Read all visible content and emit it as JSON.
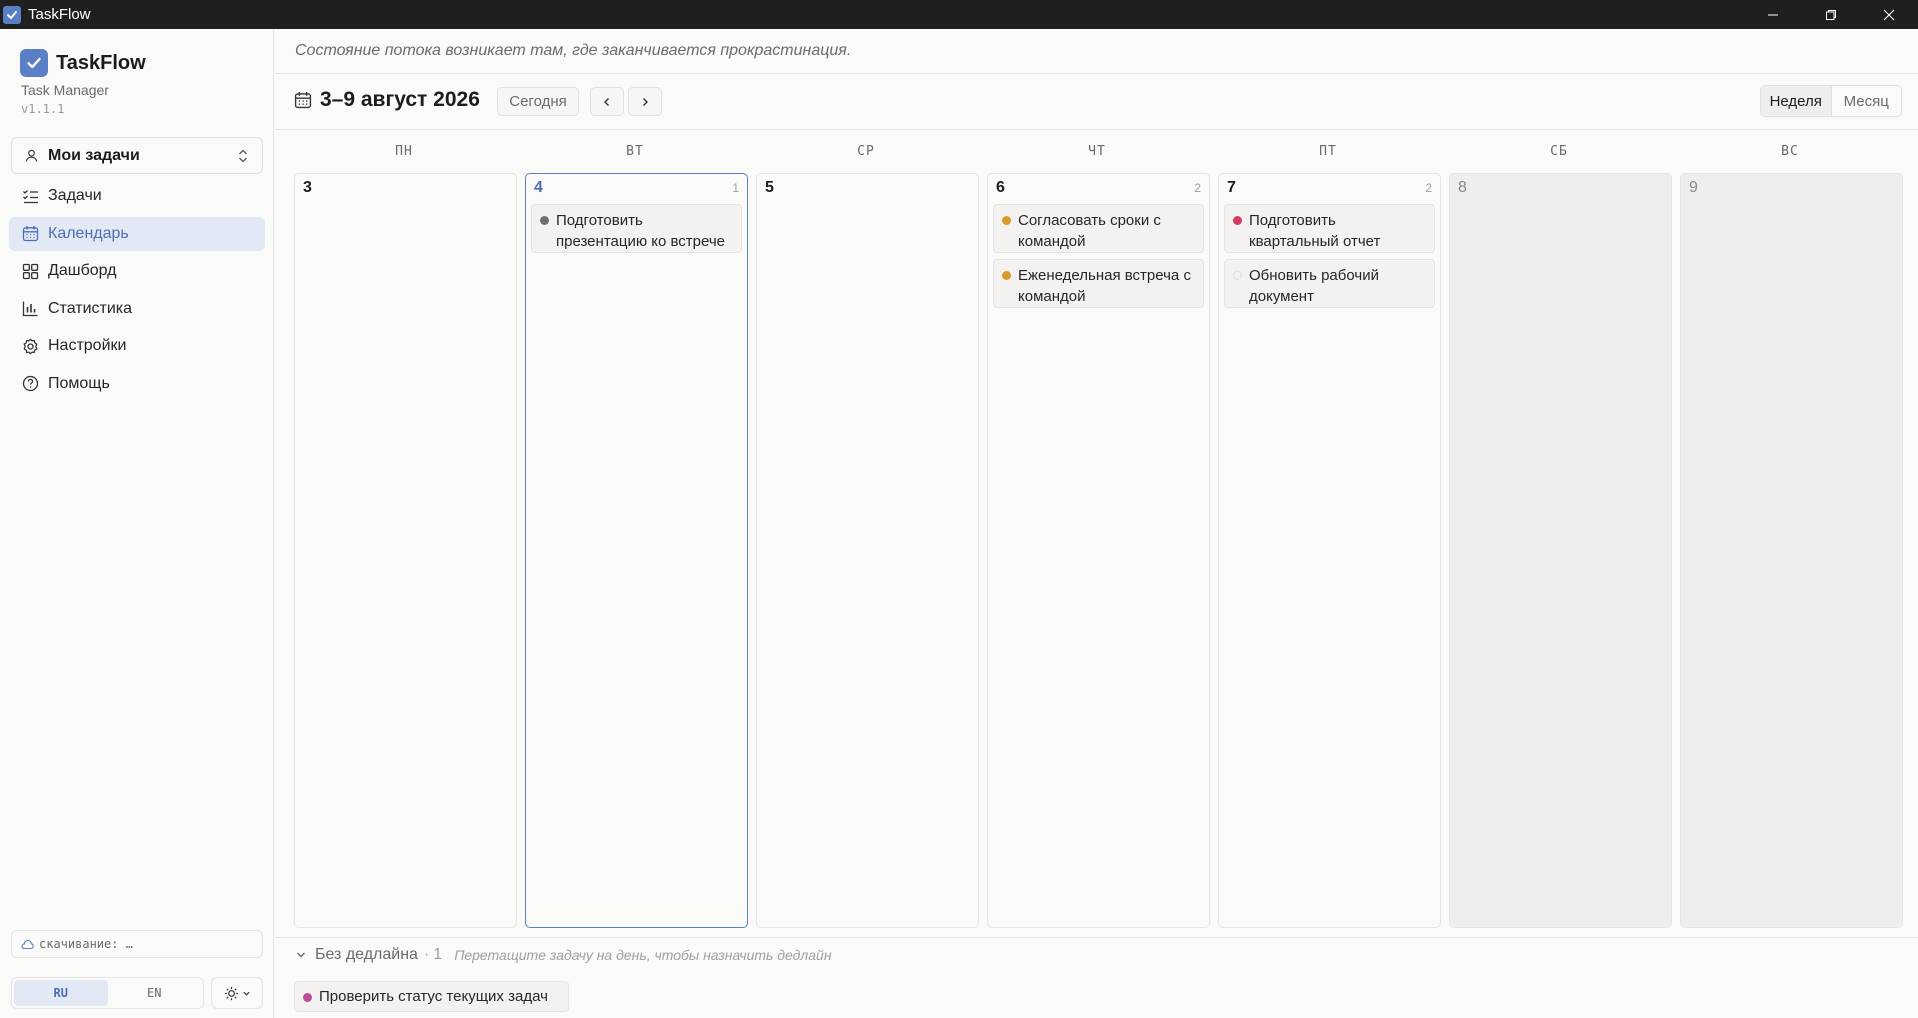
{
  "window": {
    "title": "TaskFlow"
  },
  "colors": {
    "accent": "#5b7fc7",
    "active_bg": "#e3e9f4",
    "priority_medium": "#d89a2b",
    "priority_high": "#d63a5e",
    "priority_low": "#6f6f6f",
    "priority_pink": "#c04a9a"
  },
  "sidebar": {
    "app_name": "TaskFlow",
    "subtitle": "Task Manager",
    "version": "v1.1.1",
    "workspace": "Мои задачи",
    "items": [
      {
        "label": "Задачи",
        "icon": "list-checks-icon",
        "active": false
      },
      {
        "label": "Календарь",
        "icon": "calendar-icon",
        "active": true
      },
      {
        "label": "Дашборд",
        "icon": "dashboard-icon",
        "active": false
      },
      {
        "label": "Статистика",
        "icon": "bar-chart-icon",
        "active": false
      },
      {
        "label": "Настройки",
        "icon": "gear-icon",
        "active": false
      },
      {
        "label": "Помощь",
        "icon": "help-circle-icon",
        "active": false
      }
    ],
    "sync_text": "скачивание: …",
    "lang": {
      "ru": "RU",
      "en": "EN",
      "active": "RU"
    }
  },
  "main": {
    "quote": "Состояние потока возникает там, где заканчивается прокрастинация.",
    "range_title": "3–9 август 2026",
    "today_button": "Сегодня",
    "view_week": "Неделя",
    "view_month": "Месяц",
    "active_view": "Неделя"
  },
  "week": {
    "weekday_labels": [
      "ПН",
      "ВТ",
      "СР",
      "ЧТ",
      "ПТ",
      "СБ",
      "ВС"
    ],
    "days": [
      {
        "num": "3",
        "count": "",
        "tasks": []
      },
      {
        "num": "4",
        "count": "1",
        "today": true,
        "tasks": [
          {
            "title": "Подготовить презентацию ко встрече",
            "color": "#6f6f6f"
          }
        ]
      },
      {
        "num": "5",
        "count": "",
        "tasks": []
      },
      {
        "num": "6",
        "count": "2",
        "tasks": [
          {
            "title": "Согласовать сроки с командой",
            "color": "#d89a2b"
          },
          {
            "title": "Еженедельная встреча с командой",
            "color": "#d89a2b"
          }
        ]
      },
      {
        "num": "7",
        "count": "2",
        "tasks": [
          {
            "title": "Подготовить квартальный отчет",
            "color": "#d63a5e"
          },
          {
            "title": "Обновить рабочий документ",
            "color": ""
          }
        ]
      },
      {
        "num": "8",
        "count": "",
        "weekend": true,
        "tasks": []
      },
      {
        "num": "9",
        "count": "",
        "weekend": true,
        "tasks": []
      }
    ]
  },
  "no_deadline": {
    "label": "Без дедлайна",
    "separator": "·",
    "count": "1",
    "hint": "Перетащите задачу на день, чтобы назначить дедлайн",
    "tasks": [
      {
        "title": "Проверить статус текущих задач",
        "color": "#c04a9a"
      }
    ]
  }
}
